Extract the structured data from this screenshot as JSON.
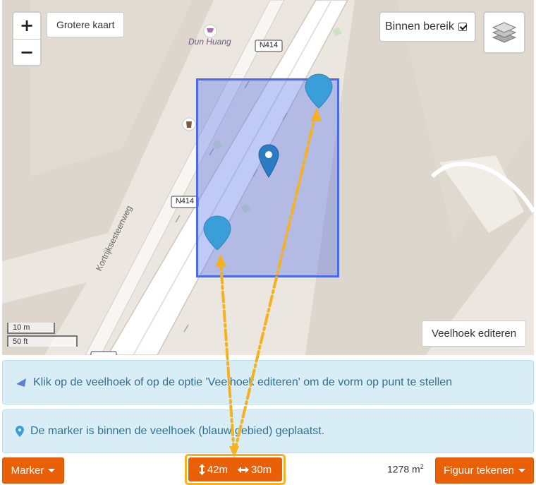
{
  "map": {
    "zoom_in_label": "+",
    "zoom_out_label": "−",
    "larger_map_label": "Grotere kaart",
    "in_range_label": "Binnen bereik",
    "in_range_checked": true,
    "edit_polygon_label": "Veelhoek editeren",
    "scale_metric": "10 m",
    "scale_imperial": "50 ft",
    "labels": {
      "poi": "Dun Huang",
      "road_top": "N414",
      "road_mid": "N414",
      "street": "Kortrijksesteenweg"
    }
  },
  "info": {
    "polygon_hint": "Klik op de veelhoek of op de optie 'Veelhoek editeren' om de vorm op punt te stellen",
    "marker_status": "De marker is binnen de veelhoek (blauw gebied) geplaatst."
  },
  "toolbar": {
    "marker_label": "Marker",
    "height_value": "42m",
    "width_value": "30m",
    "area_value": "1278 m",
    "area_unit_sup": "2",
    "figure_label": "Figuur tekenen"
  },
  "colors": {
    "orange": "#e96009",
    "highlight": "#f5b11e",
    "polygon": "#4a6bf0",
    "marker": "#3a9fd8"
  }
}
